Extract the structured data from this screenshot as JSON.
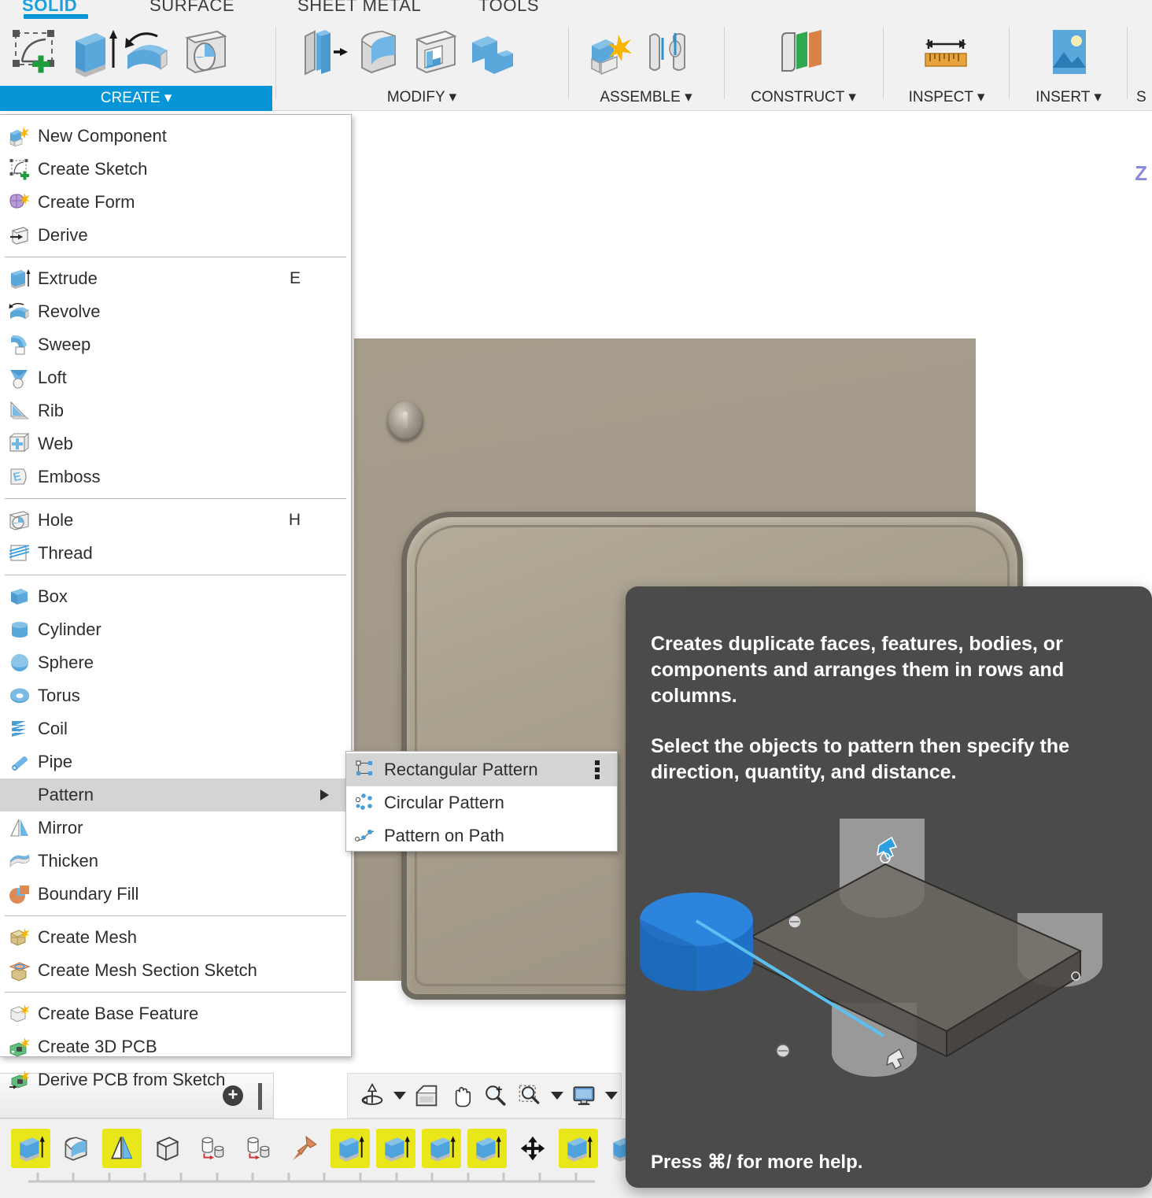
{
  "app": {
    "ribbon_tabs": [
      {
        "label": "SOLID",
        "active": true
      },
      {
        "label": "SURFACE",
        "active": false
      },
      {
        "label": "SHEET METAL",
        "active": false
      },
      {
        "label": "TOOLS",
        "active": false
      }
    ],
    "panels": [
      {
        "label": "CREATE",
        "active": true,
        "caret": "▾"
      },
      {
        "label": "MODIFY",
        "active": false,
        "caret": "▾"
      },
      {
        "label": "ASSEMBLE",
        "active": false,
        "caret": "▾"
      },
      {
        "label": "CONSTRUCT",
        "active": false,
        "caret": "▾"
      },
      {
        "label": "INSPECT",
        "active": false,
        "caret": "▾"
      },
      {
        "label": "INSERT",
        "active": false,
        "caret": "▾"
      },
      {
        "label": "S",
        "active": false,
        "caret": ""
      }
    ]
  },
  "create_menu": {
    "items": [
      {
        "label": "New Component",
        "icon": "new-component-icon",
        "shortcut": ""
      },
      {
        "label": "Create Sketch",
        "icon": "create-sketch-icon",
        "shortcut": ""
      },
      {
        "label": "Create Form",
        "icon": "create-form-icon",
        "shortcut": ""
      },
      {
        "label": "Derive",
        "icon": "derive-icon",
        "shortcut": ""
      },
      {
        "label": "Extrude",
        "icon": "extrude-icon",
        "shortcut": "E"
      },
      {
        "label": "Revolve",
        "icon": "revolve-icon",
        "shortcut": ""
      },
      {
        "label": "Sweep",
        "icon": "sweep-icon",
        "shortcut": ""
      },
      {
        "label": "Loft",
        "icon": "loft-icon",
        "shortcut": ""
      },
      {
        "label": "Rib",
        "icon": "rib-icon",
        "shortcut": ""
      },
      {
        "label": "Web",
        "icon": "web-icon",
        "shortcut": ""
      },
      {
        "label": "Emboss",
        "icon": "emboss-icon",
        "shortcut": ""
      },
      {
        "label": "Hole",
        "icon": "hole-icon",
        "shortcut": "H"
      },
      {
        "label": "Thread",
        "icon": "thread-icon",
        "shortcut": ""
      },
      {
        "label": "Box",
        "icon": "box-icon",
        "shortcut": ""
      },
      {
        "label": "Cylinder",
        "icon": "cylinder-icon",
        "shortcut": ""
      },
      {
        "label": "Sphere",
        "icon": "sphere-icon",
        "shortcut": ""
      },
      {
        "label": "Torus",
        "icon": "torus-icon",
        "shortcut": ""
      },
      {
        "label": "Coil",
        "icon": "coil-icon",
        "shortcut": ""
      },
      {
        "label": "Pipe",
        "icon": "pipe-icon",
        "shortcut": ""
      },
      {
        "label": "Pattern",
        "icon": "",
        "shortcut": "",
        "submenu": true,
        "selected": true
      },
      {
        "label": "Mirror",
        "icon": "mirror-icon",
        "shortcut": ""
      },
      {
        "label": "Thicken",
        "icon": "thicken-icon",
        "shortcut": ""
      },
      {
        "label": "Boundary Fill",
        "icon": "boundary-fill-icon",
        "shortcut": ""
      },
      {
        "label": "Create Mesh",
        "icon": "create-mesh-icon",
        "shortcut": ""
      },
      {
        "label": "Create Mesh Section Sketch",
        "icon": "create-mesh-section-sketch-icon",
        "shortcut": ""
      },
      {
        "label": "Create Base Feature",
        "icon": "create-base-feature-icon",
        "shortcut": ""
      },
      {
        "label": "Create 3D PCB",
        "icon": "create-3d-pcb-icon",
        "shortcut": ""
      },
      {
        "label": "Derive PCB from Sketch",
        "icon": "derive-pcb-from-sketch-icon",
        "shortcut": ""
      }
    ]
  },
  "pattern_submenu": {
    "items": [
      {
        "label": "Rectangular Pattern",
        "icon": "rectangular-pattern-icon",
        "selected": true,
        "kebab": true
      },
      {
        "label": "Circular Pattern",
        "icon": "circular-pattern-icon",
        "selected": false,
        "kebab": false
      },
      {
        "label": "Pattern on Path",
        "icon": "pattern-on-path-icon",
        "selected": false,
        "kebab": false
      }
    ]
  },
  "tooltip": {
    "paragraph1": "Creates duplicate faces, features, bodies, or components and arranges them in rows and columns.",
    "paragraph2": "Select the objects to pattern then specify the direction, quantity, and distance.",
    "footer": "Press ⌘/ for more help."
  },
  "canvas": {
    "axis_label_z": "Z"
  },
  "navbar": {
    "buttons": [
      {
        "icon": "orbit-icon",
        "caret": true
      },
      {
        "icon": "look-at-icon",
        "caret": false
      },
      {
        "icon": "pan-icon",
        "caret": false
      },
      {
        "icon": "zoom-icon",
        "caret": false
      },
      {
        "icon": "zoom-window-icon",
        "caret": true
      },
      {
        "icon": "display-settings-icon",
        "caret": true
      }
    ]
  },
  "timeline": {
    "items": [
      {
        "icon": "extrude-feature-icon",
        "highlighted": true
      },
      {
        "icon": "fillet-feature-icon",
        "highlighted": false
      },
      {
        "icon": "mirror-feature-icon",
        "highlighted": true
      },
      {
        "icon": "box-feature-icon",
        "highlighted": false
      },
      {
        "icon": "move-copy-feature-icon",
        "highlighted": false
      },
      {
        "icon": "move-copy-feature-icon",
        "highlighted": false
      },
      {
        "icon": "pin-feature-icon",
        "highlighted": false
      },
      {
        "icon": "extrude-feature-icon",
        "highlighted": true
      },
      {
        "icon": "extrude-feature-icon",
        "highlighted": true
      },
      {
        "icon": "extrude-feature-icon",
        "highlighted": true
      },
      {
        "icon": "extrude-feature-icon",
        "highlighted": true
      },
      {
        "icon": "move-tool-icon",
        "highlighted": false
      },
      {
        "icon": "extrude-feature-icon",
        "highlighted": true
      },
      {
        "icon": "extrude-feature-icon",
        "highlighted": false
      },
      {
        "icon": "extrude-feature-icon",
        "highlighted": true
      },
      {
        "icon": "fillet-feature-icon",
        "highlighted": false
      }
    ]
  },
  "colors": {
    "accent": "#0696d7",
    "tab_active": "#1a9fe0",
    "tooltip_bg": "#4b4b4b",
    "timeline_highlight": "#e9e61a",
    "model_body": "#a79d8b",
    "axis_z": "#8b8bdc"
  }
}
